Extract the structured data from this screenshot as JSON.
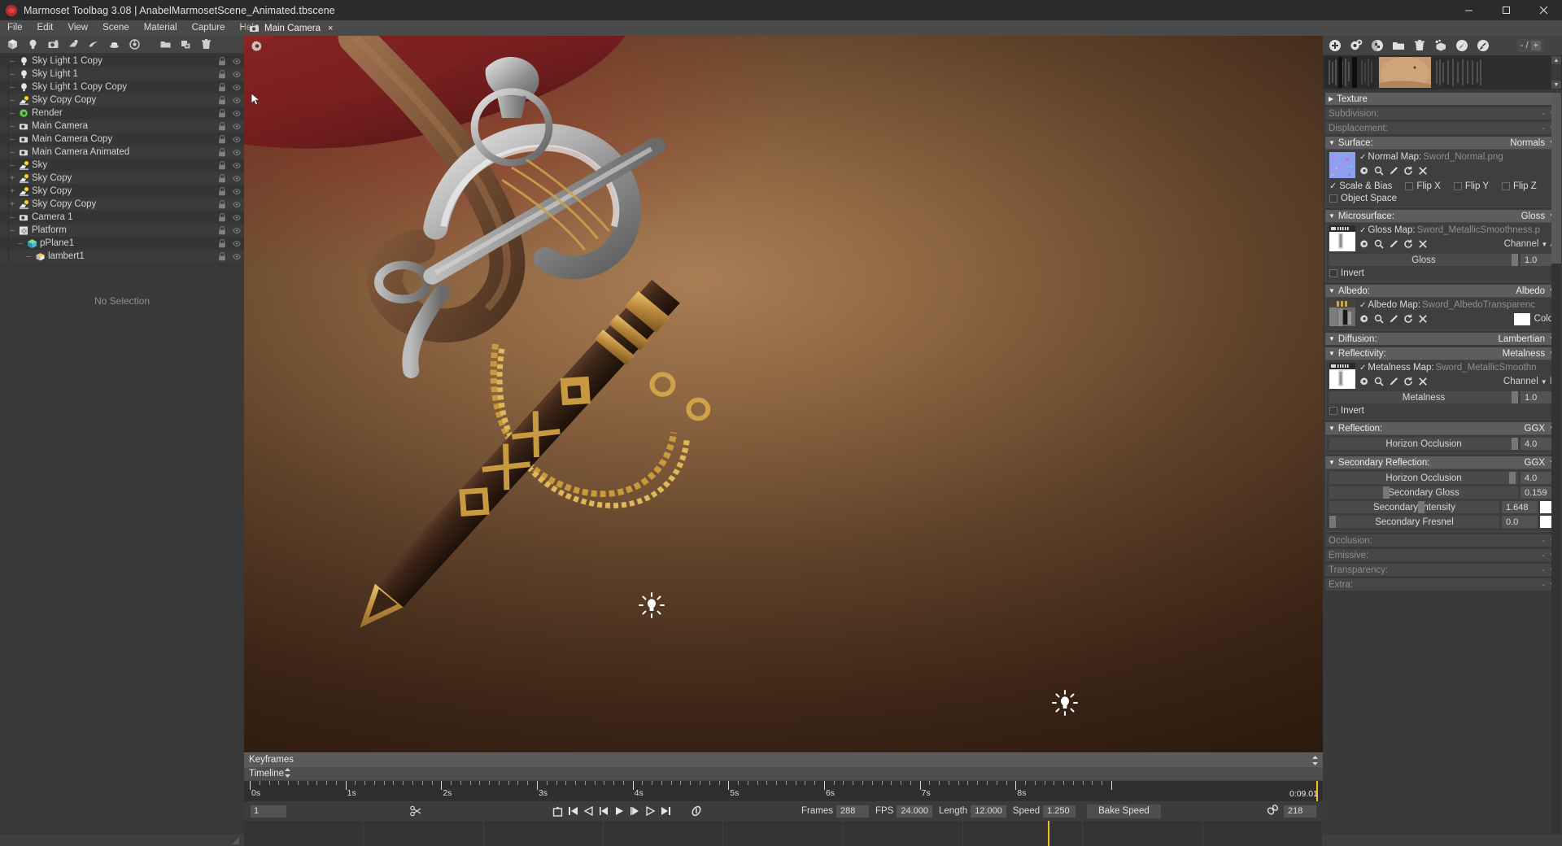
{
  "window": {
    "title": "Marmoset Toolbag 3.08  |  AnabelMarmosetScene_Animated.tbscene",
    "minimize": "–",
    "maximize": "□",
    "close": "✕"
  },
  "menubar": {
    "items": [
      "File",
      "Edit",
      "View",
      "Scene",
      "Material",
      "Capture",
      "Help"
    ]
  },
  "viewport_tab": {
    "label": "Main Camera",
    "close": "×"
  },
  "left_toolbar": {
    "icons": [
      "cube-icon",
      "light-bulb-icon",
      "camera-icon",
      "sky-icon",
      "fog-icon",
      "mesh-icon",
      "render-icon",
      "folder-icon",
      "duplicate-icon",
      "trash-icon"
    ]
  },
  "scene_tree": {
    "no_selection_label": "No Selection",
    "items": [
      {
        "label": "Sky Light 1 Copy",
        "indent": 1,
        "icon": "light-icon",
        "twig": "–"
      },
      {
        "label": "Sky Light 1",
        "indent": 1,
        "icon": "light-icon",
        "twig": "–"
      },
      {
        "label": "Sky Light 1 Copy Copy",
        "indent": 1,
        "icon": "light-icon",
        "twig": "–"
      },
      {
        "label": "Sky Copy Copy",
        "indent": 1,
        "icon": "sky-icon",
        "twig": "–"
      },
      {
        "label": "Render",
        "indent": 1,
        "icon": "gear-green-icon",
        "twig": "–"
      },
      {
        "label": "Main Camera",
        "indent": 1,
        "icon": "camera-icon",
        "twig": "–"
      },
      {
        "label": "Main Camera Copy",
        "indent": 1,
        "icon": "camera-icon",
        "twig": "–"
      },
      {
        "label": "Main Camera Animated",
        "indent": 1,
        "icon": "camera-icon",
        "twig": "–"
      },
      {
        "label": "Sky",
        "indent": 1,
        "icon": "sky-icon",
        "twig": "–"
      },
      {
        "label": "Sky Copy",
        "indent": 1,
        "icon": "sky-icon",
        "twig": "+"
      },
      {
        "label": "Sky Copy",
        "indent": 1,
        "icon": "sky-icon",
        "twig": "+"
      },
      {
        "label": "Sky Copy Copy",
        "indent": 1,
        "icon": "sky-icon",
        "twig": "+"
      },
      {
        "label": "Camera 1",
        "indent": 1,
        "icon": "camera-icon",
        "twig": "–"
      },
      {
        "label": "Platform",
        "indent": 1,
        "icon": "mesh-group-icon",
        "twig": "–"
      },
      {
        "label": "pPlane1",
        "indent": 2,
        "icon": "cube-green-icon",
        "twig": "–"
      },
      {
        "label": "lambert1",
        "indent": 3,
        "icon": "material-icon",
        "twig": "–"
      }
    ],
    "row_buttons": [
      "lock-icon",
      "eye-icon"
    ]
  },
  "material_panel": {
    "toolbar_icons": [
      "add-material-icon",
      "clone-material-icon",
      "checker-icon",
      "folder-open-icon",
      "trash-icon",
      "assign-icon",
      "brush-icon",
      "pick-icon"
    ],
    "counter": {
      "value": "- /",
      "plus": "+"
    },
    "sections": [
      {
        "name": "texture",
        "label": "Texture",
        "value": "",
        "collapsed": true,
        "dim": false
      },
      {
        "name": "subdivision",
        "label": "Subdivision:",
        "value": "-",
        "collapsed": true,
        "dim": true
      },
      {
        "name": "displacement",
        "label": "Displacement:",
        "value": "-",
        "collapsed": true,
        "dim": true
      },
      {
        "name": "surface",
        "label": "Surface:",
        "value": "Normals",
        "collapsed": false,
        "dim": false
      },
      {
        "name": "microsurface",
        "label": "Microsurface:",
        "value": "Gloss",
        "collapsed": false,
        "dim": false
      },
      {
        "name": "albedo",
        "label": "Albedo:",
        "value": "Albedo",
        "collapsed": false,
        "dim": false
      },
      {
        "name": "diffusion",
        "label": "Diffusion:",
        "value": "Lambertian",
        "collapsed": true,
        "dim": false
      },
      {
        "name": "reflectivity",
        "label": "Reflectivity:",
        "value": "Metalness",
        "collapsed": false,
        "dim": false
      },
      {
        "name": "reflection",
        "label": "Reflection:",
        "value": "GGX",
        "collapsed": false,
        "dim": false
      },
      {
        "name": "secondary_reflection",
        "label": "Secondary Reflection:",
        "value": "GGX",
        "collapsed": false,
        "dim": false
      },
      {
        "name": "occlusion",
        "label": "Occlusion:",
        "value": "-",
        "collapsed": true,
        "dim": true
      },
      {
        "name": "emissive",
        "label": "Emissive:",
        "value": "-",
        "collapsed": true,
        "dim": true
      },
      {
        "name": "transparency",
        "label": "Transparency:",
        "value": "-",
        "collapsed": true,
        "dim": true
      },
      {
        "name": "extra",
        "label": "Extra:",
        "value": "-",
        "collapsed": true,
        "dim": true
      }
    ],
    "surface": {
      "map_label": "Normal Map:",
      "map_file": "Sword_Normal.png",
      "checkboxes": [
        {
          "label": "Scale & Bias",
          "checked": true
        },
        {
          "label": "Flip X",
          "checked": false
        },
        {
          "label": "Flip Y",
          "checked": false
        },
        {
          "label": "Flip Z",
          "checked": false
        },
        {
          "label": "Object Space",
          "checked": false
        }
      ],
      "tools": [
        "gear-icon",
        "magnifier-icon",
        "pencil-icon",
        "refresh-icon",
        "close-icon"
      ]
    },
    "microsurface": {
      "map_label": "Gloss Map:",
      "map_file": "Sword_MetallicSmoothness.p",
      "channel_label": "Channel",
      "channel_value": "A",
      "slider_label": "Gloss",
      "slider_value": "1.0",
      "invert_label": "Invert",
      "invert_checked": false
    },
    "albedo": {
      "map_label": "Albedo Map:",
      "map_file": "Sword_AlbedoTransparenc",
      "color_label": "Color",
      "color_hex": "#ffffff"
    },
    "reflectivity": {
      "map_label": "Metalness Map:",
      "map_file": "Sword_MetallicSmoothn",
      "channel_label": "Channel",
      "channel_value": "R",
      "slider_label": "Metalness",
      "slider_value": "1.0",
      "invert_label": "Invert",
      "invert_checked": false
    },
    "reflection": {
      "slider_label": "Horizon Occlusion",
      "slider_value": "4.0"
    },
    "secondary_reflection": {
      "rows": [
        {
          "label": "Horizon Occlusion",
          "value": "4.0",
          "knob": 0.97,
          "swatch": null
        },
        {
          "label": "Secondary Gloss",
          "value": "0.159",
          "knob": 0.3,
          "swatch": null
        },
        {
          "label": "Secondary Intensity",
          "value": "1.648",
          "knob": 0.54,
          "swatch": "#ffffff"
        },
        {
          "label": "Secondary Fresnel",
          "value": "0.0",
          "knob": 0.02,
          "swatch": "#ffffff"
        }
      ]
    }
  },
  "timeline": {
    "keyframes_label": "Keyframes",
    "timeline_label": "Timeline",
    "ticks": [
      "0s",
      "1s",
      "2s",
      "3s",
      "4s",
      "5s",
      "6s",
      "7s",
      "8s"
    ],
    "timecode": "0:09.01",
    "playhead_position_pct": 99.5,
    "frame_value": "1",
    "transport_icons": [
      "key-add-icon",
      "skip-start-icon",
      "prev-key-icon",
      "prev-frame-icon",
      "play-icon",
      "next-frame-icon",
      "next-key-icon",
      "skip-end-icon",
      "scissors-icon",
      "link-icon"
    ],
    "fields": [
      {
        "label": "Frames",
        "value": "288"
      },
      {
        "label": "FPS",
        "value": "24.000"
      },
      {
        "label": "Length",
        "value": "12.000"
      },
      {
        "label": "Speed",
        "value": "1.250"
      }
    ],
    "bake_speed_label": "Bake Speed",
    "link_value": "218"
  },
  "colors": {
    "accent_yellow": "#f0c020",
    "panel_bg": "#3a3a3a",
    "header_bg": "#5d5d5d",
    "titlebar_bg": "#2b2b2b"
  }
}
